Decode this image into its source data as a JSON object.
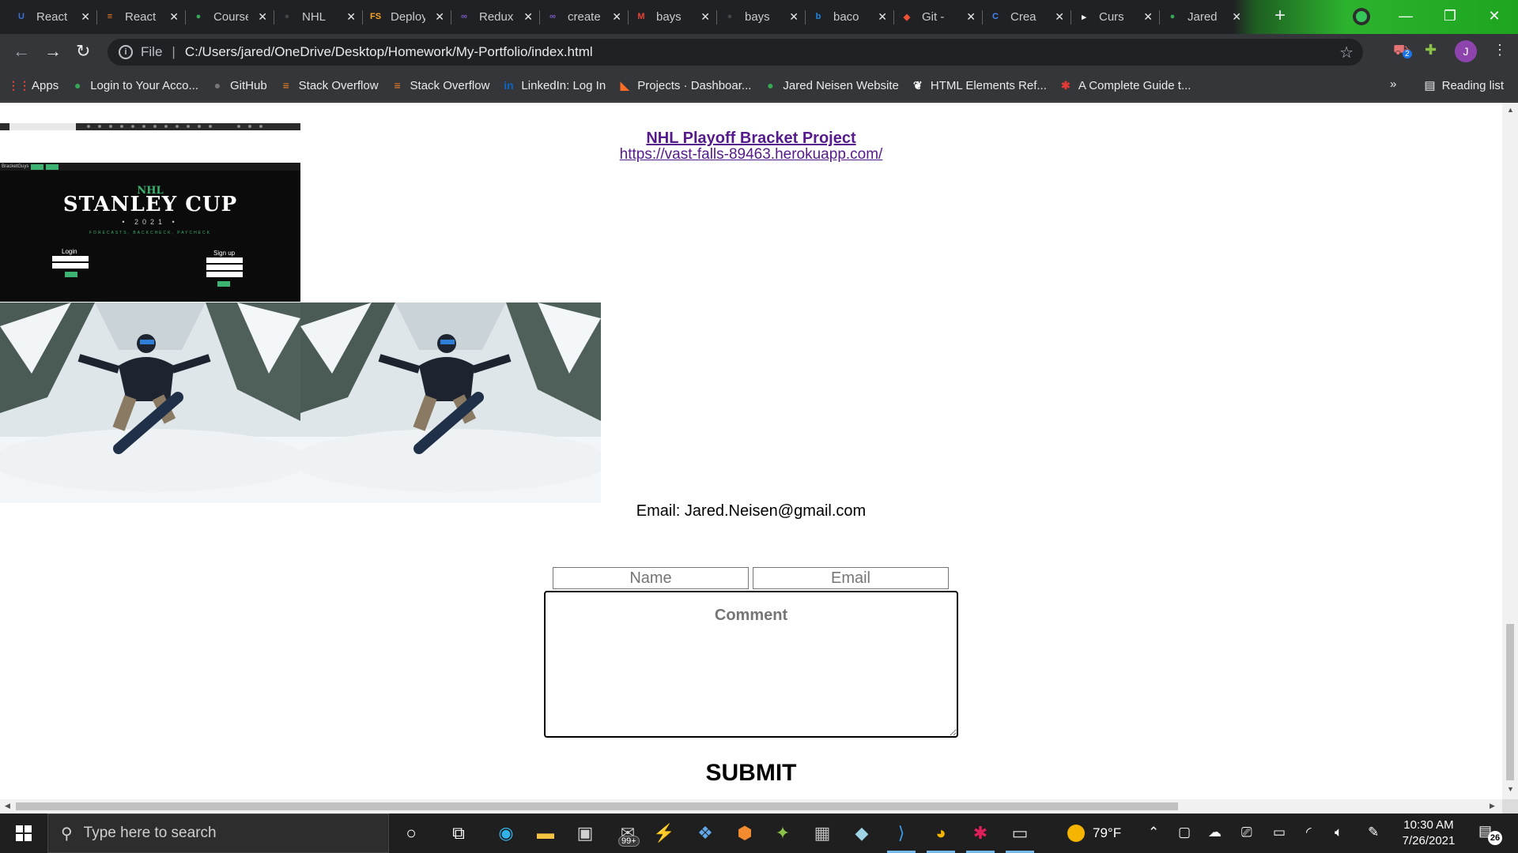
{
  "browser": {
    "tabs": [
      {
        "label": "React",
        "icon": "u-brand-icon",
        "color": "#3b6fd6"
      },
      {
        "label": "React",
        "icon": "stackoverflow-icon",
        "color": "#f48024"
      },
      {
        "label": "Course",
        "icon": "globe-icon",
        "color": "#34a853"
      },
      {
        "label": "NHL",
        "icon": "github-icon",
        "color": "#444444"
      },
      {
        "label": "Deploy",
        "icon": "fs-icon",
        "color": "#f5a623"
      },
      {
        "label": "Redux",
        "icon": "triad-icon",
        "color": "#7b5fc4"
      },
      {
        "label": "create",
        "icon": "triad-icon",
        "color": "#7b5fc4"
      },
      {
        "label": "bays",
        "icon": "gmail-icon",
        "color": "#ea4335"
      },
      {
        "label": "bays",
        "icon": "github-icon",
        "color": "#444444"
      },
      {
        "label": "baco",
        "icon": "bing-icon",
        "color": "#1e88e5"
      },
      {
        "label": "Git -",
        "icon": "git-icon",
        "color": "#f05133"
      },
      {
        "label": "Crea",
        "icon": "chrome-c-icon",
        "color": "#4285f4"
      },
      {
        "label": "Curs",
        "icon": "cursor-icon",
        "color": "#ffffff"
      },
      {
        "label": "Jared",
        "icon": "globe-icon",
        "color": "#34a853"
      }
    ],
    "address": {
      "scheme": "File",
      "url": "C:/Users/jared/OneDrive/Desktop/Homework/My-Portfolio/index.html"
    },
    "profile_initial": "J",
    "extension_badge": "2",
    "bookmarks": [
      {
        "label": "Apps",
        "icon": "apps-grid-icon"
      },
      {
        "label": "Login to Your Acco...",
        "icon": "globe-icon"
      },
      {
        "label": "GitHub",
        "icon": "github-icon"
      },
      {
        "label": "Stack Overflow",
        "icon": "stackoverflow-icon"
      },
      {
        "label": "Stack Overflow",
        "icon": "stackoverflow-icon"
      },
      {
        "label": "LinkedIn: Log In",
        "icon": "linkedin-icon"
      },
      {
        "label": "Projects · Dashboar...",
        "icon": "gitlab-icon"
      },
      {
        "label": "Jared Neisen Website",
        "icon": "globe-icon"
      },
      {
        "label": "HTML Elements Ref...",
        "icon": "html-icon"
      },
      {
        "label": "A Complete Guide t...",
        "icon": "asterisk-icon"
      }
    ],
    "reading_list": "Reading list"
  },
  "page": {
    "project": {
      "title": "NHL Playoff Bracket Project",
      "url": "https://vast-falls-89463.herokuapp.com/"
    },
    "stanley_thumb": {
      "brand": "BracketGuys",
      "nhl": "NHL",
      "title": "STANLEY CUP",
      "year": "• 2021 •",
      "tagline": "FORECASTS, BACKCHECK, PAYCHECK",
      "login": "Login",
      "signup": "Sign up"
    },
    "contact": {
      "email_line": "Email: Jared.Neisen@gmail.com",
      "name_placeholder": "Name",
      "email_placeholder": "Email",
      "comment_placeholder": "Comment",
      "submit_label": "SUBMIT"
    }
  },
  "taskbar": {
    "search_placeholder": "Type here to search",
    "store_badge": "99+",
    "temperature": "79°F",
    "time": "10:30 AM",
    "date": "7/26/2021",
    "notifications": "26"
  }
}
